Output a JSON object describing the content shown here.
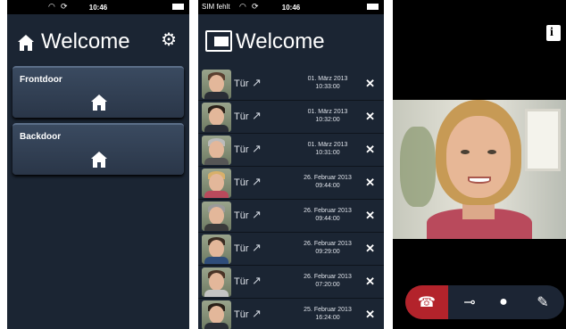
{
  "status_bar": {
    "screen1": {
      "time": "10:46",
      "carrier": ""
    },
    "screen2": {
      "time": "10:46",
      "carrier": "SIM fehlt"
    }
  },
  "screen1": {
    "title": "Welcome",
    "doors": [
      {
        "label": "Frontdoor"
      },
      {
        "label": "Backdoor"
      }
    ],
    "icons": [
      "house-icon",
      "settings-gears-icon"
    ]
  },
  "screen2": {
    "title": "Welcome",
    "items": [
      {
        "label": "Tür",
        "date": "01. März 2013",
        "time": "10:33:00"
      },
      {
        "label": "Tür",
        "date": "01. März 2013",
        "time": "10:32:00"
      },
      {
        "label": "Tür",
        "date": "01. März 2013",
        "time": "10:31:00"
      },
      {
        "label": "Tür",
        "date": "26. Februar 2013",
        "time": "09:44:00"
      },
      {
        "label": "Tür",
        "date": "26. Februar 2013",
        "time": "09:44:00"
      },
      {
        "label": "Tür",
        "date": "26. Februar 2013",
        "time": "09:29:00"
      },
      {
        "label": "Tür",
        "date": "26. Februar 2013",
        "time": "07:20:00"
      },
      {
        "label": "Tür",
        "date": "25. Februar 2013",
        "time": "16:24:00"
      }
    ],
    "delete_glyph": "✕",
    "arrow_glyph": "↗"
  },
  "screen3": {
    "controls": [
      "hangup-icon",
      "key-icon",
      "light-bulb-icon",
      "microphone-icon"
    ],
    "info_glyph": "i",
    "accent_color": "#b3232b"
  }
}
